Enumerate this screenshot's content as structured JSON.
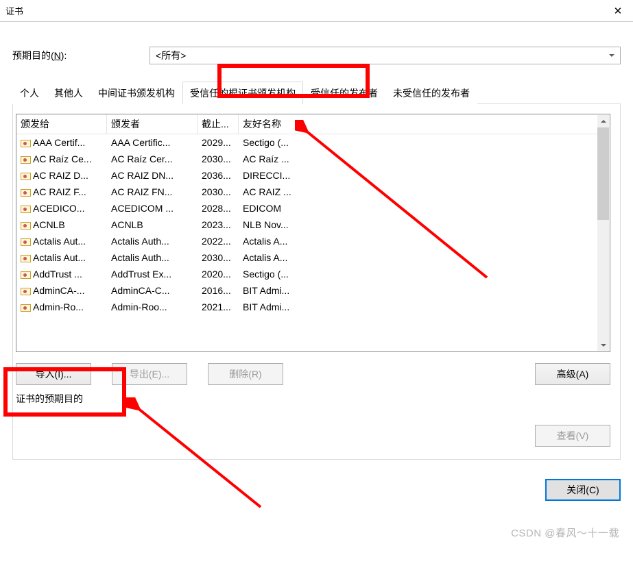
{
  "window": {
    "title": "证书"
  },
  "purpose": {
    "label_pre": "预期目的(",
    "label_u": "N",
    "label_post": "):",
    "value": "<所有>"
  },
  "tabs": [
    {
      "label": "个人"
    },
    {
      "label": "其他人"
    },
    {
      "label": "中间证书颁发机构"
    },
    {
      "label": "受信任的根证书颁发机构",
      "active": true
    },
    {
      "label": "受信任的发布者"
    },
    {
      "label": "未受信任的发布者"
    }
  ],
  "columns": {
    "c1": "颁发给",
    "c2": "颁发者",
    "c3": "截止...",
    "c4": "友好名称"
  },
  "rows": [
    {
      "c1": "AAA Certif...",
      "c2": "AAA Certific...",
      "c3": "2029...",
      "c4": "Sectigo (..."
    },
    {
      "c1": "AC Raíz Ce...",
      "c2": "AC Raíz Cer...",
      "c3": "2030...",
      "c4": "AC Raíz ..."
    },
    {
      "c1": "AC RAIZ D...",
      "c2": "AC RAIZ DN...",
      "c3": "2036...",
      "c4": "DIRECCI..."
    },
    {
      "c1": "AC RAIZ F...",
      "c2": "AC RAIZ FN...",
      "c3": "2030...",
      "c4": "AC RAIZ ..."
    },
    {
      "c1": "ACEDICO...",
      "c2": "ACEDICOM ...",
      "c3": "2028...",
      "c4": "EDICOM"
    },
    {
      "c1": "ACNLB",
      "c2": "ACNLB",
      "c3": "2023...",
      "c4": "NLB Nov..."
    },
    {
      "c1": "Actalis Aut...",
      "c2": "Actalis Auth...",
      "c3": "2022...",
      "c4": "Actalis A..."
    },
    {
      "c1": "Actalis Aut...",
      "c2": "Actalis Auth...",
      "c3": "2030...",
      "c4": "Actalis A..."
    },
    {
      "c1": "AddTrust ...",
      "c2": "AddTrust Ex...",
      "c3": "2020...",
      "c4": "Sectigo (..."
    },
    {
      "c1": "AdminCA-...",
      "c2": "AdminCA-C...",
      "c3": "2016...",
      "c4": "BIT Admi..."
    },
    {
      "c1": "Admin-Ro...",
      "c2": "Admin-Roo...",
      "c3": "2021...",
      "c4": "BIT Admi..."
    }
  ],
  "buttons": {
    "import": "导入(I)...",
    "export": "导出(E)...",
    "remove": "删除(R)",
    "advanced": "高级(A)",
    "view": "查看(V)",
    "close": "关闭(C)"
  },
  "group_label": "证书的预期目的",
  "watermark": "CSDN @春风～十一载"
}
